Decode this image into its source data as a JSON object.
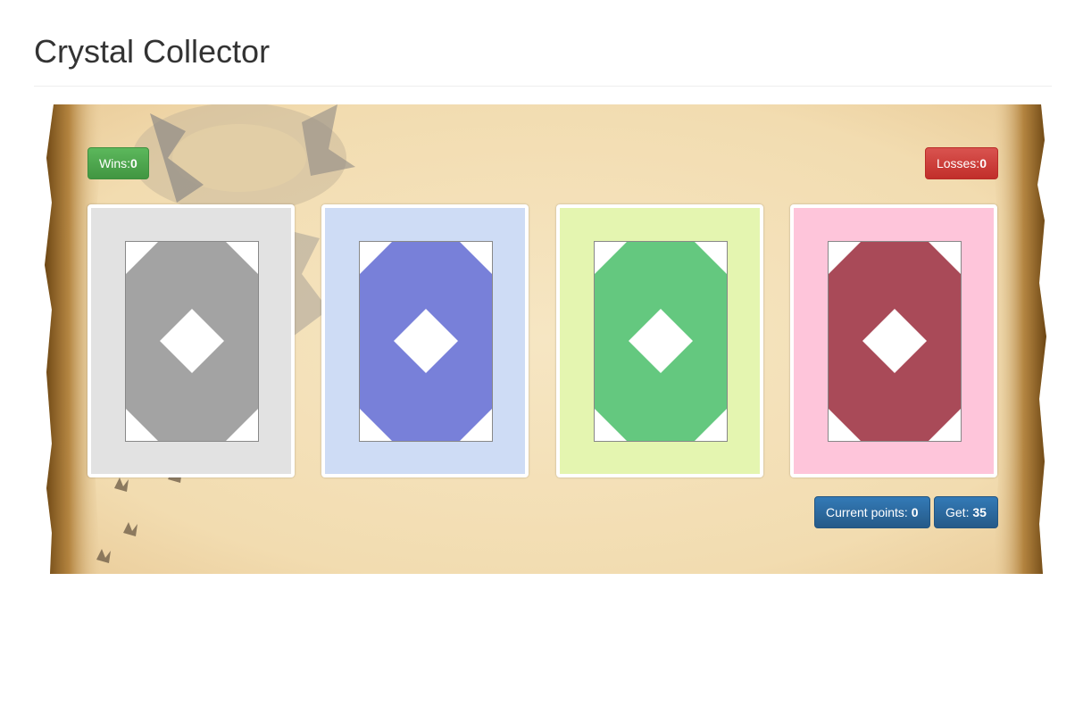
{
  "page": {
    "title": "Crystal Collector"
  },
  "scoreboard": {
    "wins_label": "Wins:",
    "wins_value": "0",
    "losses_label": "Losses:",
    "losses_value": "0"
  },
  "crystals": [
    {
      "name": "crystal-gray",
      "bg": "#e2e2e2",
      "fill": "#a3a3a3"
    },
    {
      "name": "crystal-blue",
      "bg": "#cedcf5",
      "fill": "#7880d9"
    },
    {
      "name": "crystal-green",
      "bg": "#e4f5b0",
      "fill": "#64c87f"
    },
    {
      "name": "crystal-red",
      "bg": "#fec5da",
      "fill": "#a94a58"
    }
  ],
  "status": {
    "current_label": "Current points: ",
    "current_value": "0",
    "target_label": "Get: ",
    "target_value": "35"
  }
}
